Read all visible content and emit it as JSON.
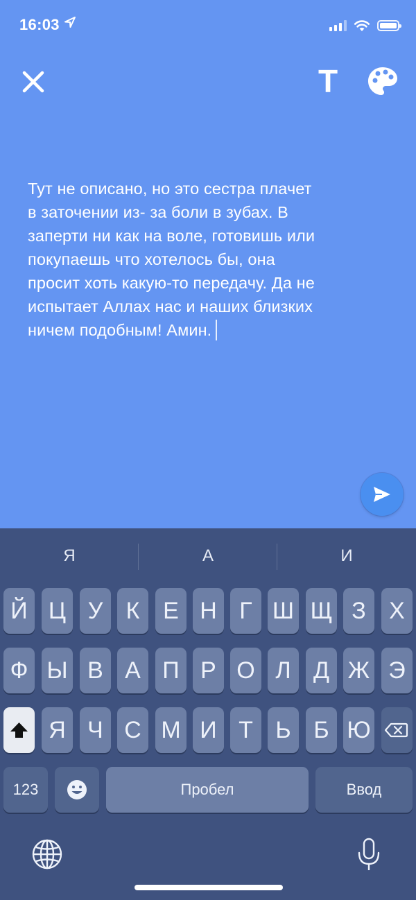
{
  "status_bar": {
    "time": "16:03",
    "location_icon": "location-arrow-icon",
    "signal_icon": "cellular-signal-icon",
    "wifi_icon": "wifi-icon",
    "battery_icon": "battery-icon"
  },
  "toolbar": {
    "close_icon": "close-icon",
    "text_style_label": "T",
    "palette_icon": "palette-icon"
  },
  "message": {
    "text": "Тут не описано, но это сестра плачет\nв заточении из- за боли в зубах. В\nзаперти ни как на воле, готовишь или\nпокупаешь что хотелось бы, она\nпросит хоть какую-то передачу. Да не\nиспытает Аллах нас и наших близких\nничем подобным! Амин."
  },
  "send_icon": "send-icon",
  "colors": {
    "background": "#6495f2",
    "keyboard": "#3f527f",
    "key": "#6d7fa6",
    "send": "#4a8ff0"
  },
  "keyboard": {
    "suggestions": [
      "Я",
      "А",
      "И"
    ],
    "row1": [
      "Й",
      "Ц",
      "У",
      "К",
      "Е",
      "Н",
      "Г",
      "Ш",
      "Щ",
      "З",
      "Х"
    ],
    "row2": [
      "Ф",
      "Ы",
      "В",
      "А",
      "П",
      "Р",
      "О",
      "Л",
      "Д",
      "Ж",
      "Э"
    ],
    "row3": [
      "Я",
      "Ч",
      "С",
      "М",
      "И",
      "Т",
      "Ь",
      "Б",
      "Ю"
    ],
    "shift_icon": "shift-icon",
    "delete_icon": "delete-icon",
    "numbers_label": "123",
    "emoji_icon": "emoji-icon",
    "space_label": "Пробел",
    "return_label": "Ввод",
    "globe_icon": "globe-icon",
    "mic_icon": "microphone-icon"
  }
}
